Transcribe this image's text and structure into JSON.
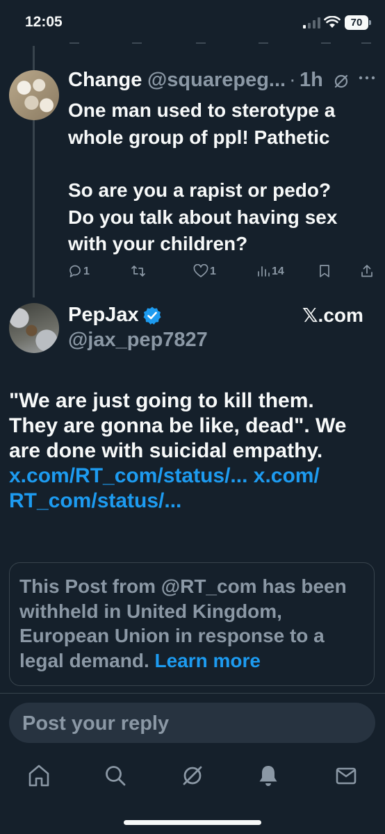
{
  "status_bar": {
    "time": "12:05",
    "battery": "70"
  },
  "reply_post": {
    "author_name": "Change",
    "author_handle": "@squarepeg...",
    "separator": "·",
    "timestamp": "1h",
    "text_lines": [
      "One man used to sterotype a",
      "whole group of ppl! Pathetic",
      "",
      "So are you a rapist or pedo?",
      "Do you talk about having sex",
      "with your children?"
    ],
    "actions": {
      "replies": "1",
      "likes": "1",
      "views": "14"
    }
  },
  "main_post": {
    "author_name": "PepJax",
    "author_handle": "@jax_pep7827",
    "brand": "𝕏.com",
    "text": {
      "line1": "\"We are just going to kill them.",
      "line2": "They are gonna be like, dead\". We",
      "line3": "are done with suicidal empathy.",
      "link1": "x.com/RT_com/status/...",
      "link2_a": "x.com/",
      "link2_b": "RT_com/status/..."
    },
    "withheld_notice": {
      "text": "This Post from @RT_com has been withheld in United Kingdom, European Union in response to a legal demand.",
      "learn_more": "Learn more"
    }
  },
  "composer": {
    "placeholder": "Post your reply"
  },
  "colors": {
    "background": "#15202b",
    "accent": "#1d9bf0",
    "secondary_text": "#8b98a5",
    "border": "#38444d"
  },
  "tab_bar": {
    "icons": [
      "home-icon",
      "search-icon",
      "grok-icon",
      "notifications-icon",
      "messages-icon"
    ]
  }
}
